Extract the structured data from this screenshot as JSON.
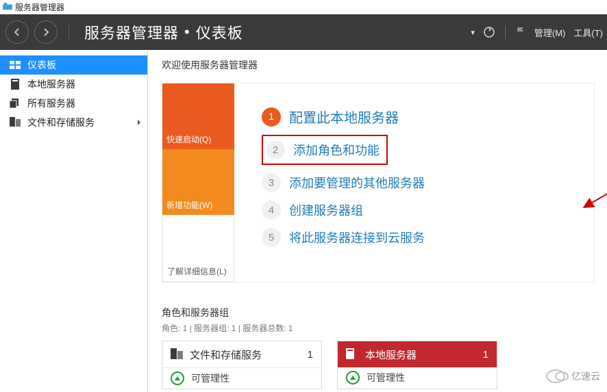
{
  "titlebar": {
    "title": "服务器管理器"
  },
  "header": {
    "breadcrumb_app": "服务器管理器",
    "breadcrumb_page": "仪表板",
    "sep": "•",
    "menu_manage": "管理(M)",
    "menu_tools": "工具(T)"
  },
  "sidebar": {
    "items": [
      {
        "label": "仪表板",
        "icon": "dashboard-icon",
        "active": true
      },
      {
        "label": "本地服务器",
        "icon": "server-icon"
      },
      {
        "label": "所有服务器",
        "icon": "servers-icon"
      },
      {
        "label": "文件和存储服务",
        "icon": "storage-icon",
        "expandable": true
      }
    ]
  },
  "welcome": {
    "title": "欢迎使用服务器管理器"
  },
  "quickstart": {
    "left": [
      {
        "label": "快速启动(Q)"
      },
      {
        "label": "新增功能(W)"
      },
      {
        "label": "了解详细信息(L)"
      }
    ],
    "steps": [
      {
        "n": "1",
        "label": "配置此本地服务器",
        "primary": true
      },
      {
        "n": "2",
        "label": "添加角色和功能",
        "highlight": true
      },
      {
        "n": "3",
        "label": "添加要管理的其他服务器"
      },
      {
        "n": "4",
        "label": "创建服务器组"
      },
      {
        "n": "5",
        "label": "将此服务器连接到云服务"
      }
    ]
  },
  "roles": {
    "title": "角色和服务器组",
    "sub": "角色: 1 | 服务器组: 1 | 服务器总数: 1",
    "tiles": [
      {
        "title": "文件和存储服务",
        "count": "1",
        "row": "可管理性",
        "style": "plain"
      },
      {
        "title": "本地服务器",
        "count": "1",
        "row": "可管理性",
        "style": "red"
      }
    ]
  },
  "watermark": {
    "text": "亿速云"
  }
}
